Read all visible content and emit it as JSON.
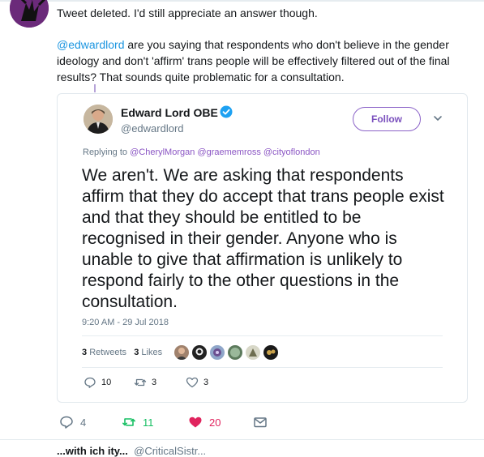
{
  "tweet": {
    "status_line": "Tweet deleted. I'd still appreciate an answer though.",
    "body_mention": "@edwardlord",
    "body_rest": " are you saying that respondents who don't believe in the gender ideology and don't 'affirm' trans people will be effectively filtered out of the final results? That sounds quite problematic for a consultation.",
    "actions": {
      "replies": "4",
      "retweets": "11",
      "likes": "20"
    }
  },
  "quoted": {
    "name": "Edward Lord OBE",
    "handle": "@edwardlord",
    "follow_label": "Follow",
    "replying_prefix": "Replying to ",
    "replying_to": [
      "@CherylMorgan",
      "@graememross",
      "@cityoflondon"
    ],
    "text": "We aren't. We are asking that respondents affirm that they do accept that trans people exist and that they should be entitled to be recognised in their gender. Anyone who is unable to give that affirmation is unlikely to respond fairly to the other questions in the consultation.",
    "timestamp": "9:20 AM - 29 Jul 2018",
    "stats": {
      "retweets_count": "3",
      "retweets_label": "Retweets",
      "likes_count": "3",
      "likes_label": "Likes"
    },
    "actions": {
      "replies": "10",
      "retweets": "3",
      "likes": "3"
    }
  },
  "next_row": {
    "name_fragment": "...with ich ity...",
    "handle_fragment": "@CriticalSistr..."
  },
  "colors": {
    "mention": "#1b95e0",
    "follow_purple": "#7a4fbd",
    "retweet_green": "#17bf63",
    "like_red": "#e0245e",
    "verified_blue": "#1da1f2"
  }
}
